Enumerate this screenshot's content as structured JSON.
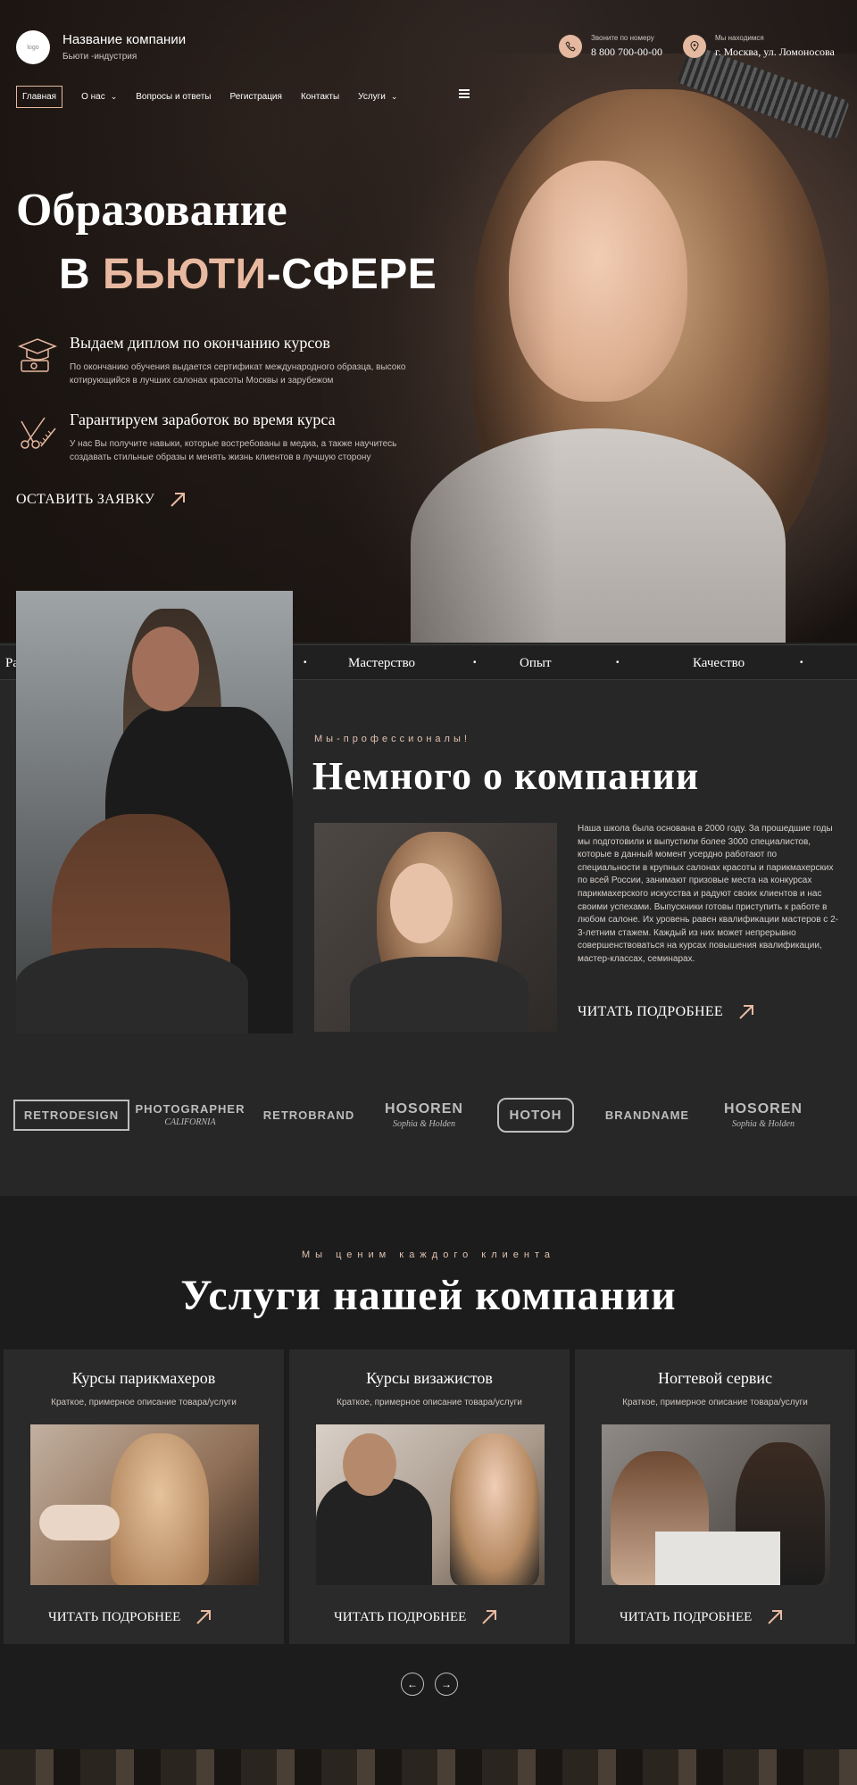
{
  "header": {
    "logo_text": "logo",
    "company_name": "Название компании",
    "company_sub": "Бьюти -индустрия",
    "phone_label": "Звоните по номеру",
    "phone": "8 800 700-00-00",
    "location_label": "Мы находимся",
    "location": "г. Москва, ул. Ломоносова"
  },
  "nav": {
    "items": [
      {
        "label": "Главная"
      },
      {
        "label": "О нас"
      },
      {
        "label": "Вопросы и ответы"
      },
      {
        "label": "Регистрация"
      },
      {
        "label": "Контакты"
      },
      {
        "label": "Услуги"
      }
    ]
  },
  "hero": {
    "title_line1": "Образование",
    "title_prefix": "В ",
    "title_accent": "БЬЮТИ",
    "title_suffix": "-СФЕРЕ",
    "features": [
      {
        "title": "Выдаем диплом по окончанию курсов",
        "desc": "По окончанию обучения выдается сертификат международного образца, высоко котирующийся в лучших салонах красоты Москвы и зарубежом",
        "icon": "graduation-icon"
      },
      {
        "title": "Гарантируем заработок во время курса",
        "desc": "У нас Вы получите навыки, которые востребованы в медиа, а также научитесь создавать стильные образы и менять жизнь клиентов в лучшую сторону",
        "icon": "scissors-comb-icon"
      }
    ],
    "cta": "ОСТАВИТЬ ЗАЯВКУ"
  },
  "marquee": {
    "items": [
      "Ра",
      "Мастерство",
      "Опыт",
      "Качество"
    ]
  },
  "about": {
    "pre": "Мы-профессионалы!",
    "title": "Немного о компании",
    "text": "Наша школа была основана в 2000 году. За прошедшие годы мы подготовили и выпустили более 3000 специалистов, которые в данный момент усердно работают по специальности в крупных салонах красоты и парикмахерских по всей России, занимают призовые места на конкурсах парикмахерского искусства и радуют своих клиентов и нас своими успехами. Выпускники готовы приступить к работе в любом салоне. Их уровень равен квалификации мастеров с 2-3-летним стажем. Каждый из них может непрерывно совершенствоваться на курсах повышения квалификации, мастер-классах, семинарах.",
    "cta": "ЧИТАТЬ ПОДРОБНЕЕ"
  },
  "brands": [
    {
      "main": "RETRODESIGN",
      "sub": ""
    },
    {
      "main": "PHOTOGRAPHER",
      "sub": "CALIFORNIA"
    },
    {
      "main": "RETROBRAND",
      "sub": ""
    },
    {
      "main": "HOSOREN",
      "sub": "Sophia & Holden"
    },
    {
      "main": "HOTOH",
      "sub": ""
    },
    {
      "main": "BRANDNAME",
      "sub": ""
    },
    {
      "main": "HOSOREN",
      "sub": "Sophia & Holden"
    }
  ],
  "services": {
    "pre": "Мы ценим каждого клиента",
    "title": "Услуги нашей компании",
    "cards": [
      {
        "title": "Курсы парикмахеров",
        "desc": "Краткое, примерное описание товара/услуги",
        "cta": "ЧИТАТЬ ПОДРОБНЕЕ"
      },
      {
        "title": "Курсы визажистов",
        "desc": "Краткое, примерное описание товара/услуги",
        "cta": "ЧИТАТЬ ПОДРОБНЕЕ"
      },
      {
        "title": "Ногтевой сервис",
        "desc": "Краткое, примерное описание товара/услуги",
        "cta": "ЧИТАТЬ ПОДРОБНЕЕ"
      }
    ]
  },
  "colors": {
    "accent": "#e8b9a0",
    "background": "#232323",
    "card": "#2a2a2a"
  }
}
